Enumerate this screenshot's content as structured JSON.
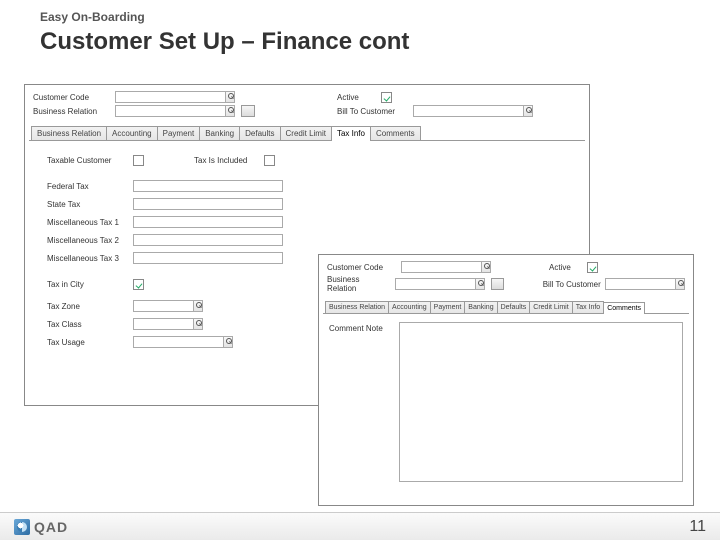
{
  "slide": {
    "header": "Easy On-Boarding",
    "title": "Customer Set Up – Finance cont",
    "page_number": "11",
    "logo_text": "QAD"
  },
  "common": {
    "labels": {
      "customer_code": "Customer Code",
      "business_relation": "Business Relation",
      "active": "Active",
      "bill_to_customer": "Bill To Customer"
    },
    "tabs": [
      "Business Relation",
      "Accounting",
      "Payment",
      "Banking",
      "Defaults",
      "Credit Limit",
      "Tax Info",
      "Comments"
    ],
    "values": {
      "customer_code": "",
      "business_relation": "",
      "bill_to_customer": "",
      "active_checked": true
    }
  },
  "window1": {
    "active_tab_index": 6,
    "tax": {
      "labels": {
        "taxable_customer": "Taxable Customer",
        "tax_is_included": "Tax Is Included",
        "federal_tax": "Federal Tax",
        "state_tax": "State Tax",
        "misc_tax_1": "Miscellaneous Tax 1",
        "misc_tax_2": "Miscellaneous Tax 2",
        "misc_tax_3": "Miscellaneous Tax 3",
        "tax_in_city": "Tax in City",
        "tax_zone": "Tax Zone",
        "tax_class": "Tax Class",
        "tax_usage": "Tax Usage"
      },
      "values": {
        "taxable_customer": false,
        "tax_is_included": false,
        "federal_tax": "",
        "state_tax": "",
        "misc_tax_1": "",
        "misc_tax_2": "",
        "misc_tax_3": "",
        "tax_in_city": true,
        "tax_zone": "",
        "tax_class": "",
        "tax_usage": ""
      }
    }
  },
  "window2": {
    "active_tab_index": 7,
    "comments": {
      "label": "Comment Note",
      "value": ""
    }
  }
}
